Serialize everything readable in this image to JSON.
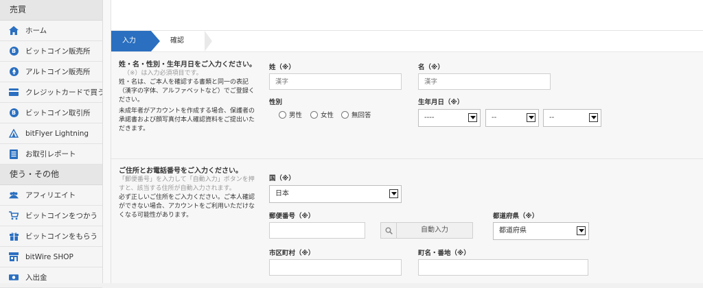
{
  "sidebar": {
    "section1": "売買",
    "items1": [
      {
        "label": "ホーム",
        "icon": "home-icon"
      },
      {
        "label": "ビットコイン販売所",
        "icon": "bitcoin-icon"
      },
      {
        "label": "アルトコイン販売所",
        "icon": "ethereum-icon"
      },
      {
        "label": "クレジットカードで買う",
        "icon": "credit-card-icon"
      },
      {
        "label": "ビットコイン取引所",
        "icon": "bitcoin-icon"
      },
      {
        "label": "bitFlyer Lightning",
        "icon": "lightning-triangle-icon"
      },
      {
        "label": "お取引レポート",
        "icon": "report-icon"
      }
    ],
    "section2": "使う・その他",
    "items2": [
      {
        "label": "アフィリエイト",
        "icon": "users-icon"
      },
      {
        "label": "ビットコインをつかう",
        "icon": "cart-icon"
      },
      {
        "label": "ビットコインをもらう",
        "icon": "gift-icon"
      },
      {
        "label": "bitWire SHOP",
        "icon": "shop-icon"
      },
      {
        "label": "入出金",
        "icon": "money-icon"
      }
    ]
  },
  "steps": {
    "step1": "入力",
    "step2": "確認"
  },
  "section_name": {
    "heading": "姓・名・性別・生年月日をご入力ください。",
    "required_note": "（※）は入力必須項目です。",
    "para1": "姓・名は、ご本人を確認する書類と同一の表記（漢字の字体、アルファベットなど）でご登録ください。",
    "para2": "未成年者がアカウントを作成する場合、保護者の承諾書および顔写真付本人確認資料をご提出いただきます。",
    "last_name_label": "姓（※）",
    "last_name_placeholder": "漢字",
    "first_name_label": "名（※）",
    "first_name_placeholder": "漢字",
    "gender_label": "性別",
    "gender_options": [
      "男性",
      "女性",
      "無回答"
    ],
    "birth_label": "生年月日（※）",
    "birth_year": "----",
    "birth_month": "--",
    "birth_day": "--"
  },
  "section_address": {
    "heading": "ご住所とお電話番号をご入力ください。",
    "note": "「郵便番号」を入力して「自動入力」ボタンを押すと、該当する住所が自動入力されます。",
    "para": "必ず正しいご住所をご入力ください。ご本人確認ができない場合、アカウントをご利用いただけなくなる可能性があります。",
    "country_label": "国（※）",
    "country_value": "日本",
    "postal_label": "郵便番号（※）",
    "auto_button": "自動入力",
    "prefecture_label": "都道府県（※）",
    "prefecture_value": "都道府県",
    "city_label": "市区町村（※）",
    "street_label": "町名・番地（※）"
  }
}
